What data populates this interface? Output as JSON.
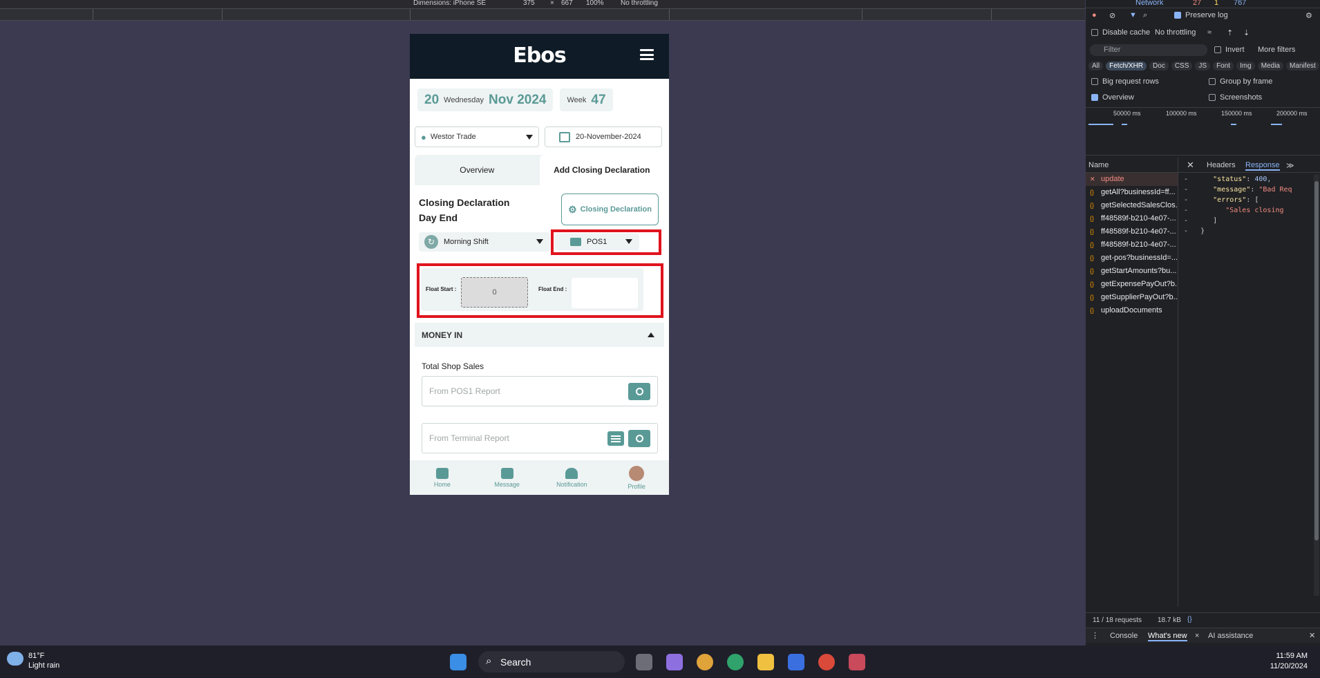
{
  "device_toolbar": {
    "dimensions_label": "Dimensions: iPhone SE",
    "width": "375",
    "times": "×",
    "height": "667",
    "zoom": "100%",
    "throttle": "No throttling"
  },
  "app": {
    "logo": "Ebos",
    "date_chip": {
      "day": "20",
      "weekday": "Wednesday",
      "month_year": "Nov 2024"
    },
    "week_chip": {
      "label": "Week",
      "number": "47"
    },
    "location": "Westor Trade",
    "date_picker": "20-November-2024",
    "tabs": [
      {
        "label": "Overview"
      },
      {
        "label": "Add Closing Declaration"
      }
    ],
    "closing_title_1": "Closing Declaration",
    "closing_title_2": "Day End",
    "closing_button": "Closing Declaration",
    "shift": "Morning Shift",
    "pos": "POS1",
    "float_start_label": "Float Start :",
    "float_start_value": "0",
    "float_end_label": "Float End :",
    "money_in": "MONEY IN",
    "total_shop_sales": "Total Shop Sales",
    "pos_report_placeholder": "From POS1 Report",
    "terminal_report_placeholder": "From Terminal Report",
    "nav": [
      {
        "label": "Home"
      },
      {
        "label": "Message"
      },
      {
        "label": "Notification"
      },
      {
        "label": "Profile"
      }
    ]
  },
  "devtools": {
    "tab": "Network",
    "errors": "27",
    "warnings": "1",
    "info": "767",
    "preserve_log": "Preserve log",
    "disable_cache": "Disable cache",
    "throttle": "No throttling",
    "filter_placeholder": "Filter",
    "invert": "Invert",
    "more_filters": "More filters",
    "type_filters": [
      "All",
      "Fetch/XHR",
      "Doc",
      "CSS",
      "JS",
      "Font",
      "Img",
      "Media",
      "Manifest"
    ],
    "big_rows": "Big request rows",
    "group_by_frame": "Group by frame",
    "overview": "Overview",
    "screenshots": "Screenshots",
    "timeline_ticks": [
      "50000 ms",
      "100000 ms",
      "150000 ms",
      "200000 ms"
    ],
    "name_header": "Name",
    "detail_tabs": [
      "Headers",
      "Response"
    ],
    "requests": [
      "update",
      "getAll?businessId=ff...",
      "getSelectedSalesClos...",
      "ff48589f-b210-4e07-...",
      "ff48589f-b210-4e07-...",
      "ff48589f-b210-4e07-...",
      "get-pos?businessId=...",
      "getStartAmounts?bu...",
      "getExpensePayOut?b...",
      "getSupplierPayOut?b...",
      "uploadDocuments"
    ],
    "response_status_key": "\"status\"",
    "response_status_val": "400,",
    "response_message_key": "\"message\"",
    "response_message_val": "\"Bad Req",
    "response_errors_key": "\"errors\"",
    "response_error_item": "\"Sales closing",
    "footer_requests": "11 / 18 requests",
    "footer_size": "18.7 kB",
    "drawer_tabs": [
      "Console",
      "What's new",
      "AI assistance"
    ]
  },
  "taskbar": {
    "temp": "81°F",
    "weather": "Light rain",
    "search": "Search",
    "time": "11:59 AM",
    "date": "11/20/2024"
  }
}
